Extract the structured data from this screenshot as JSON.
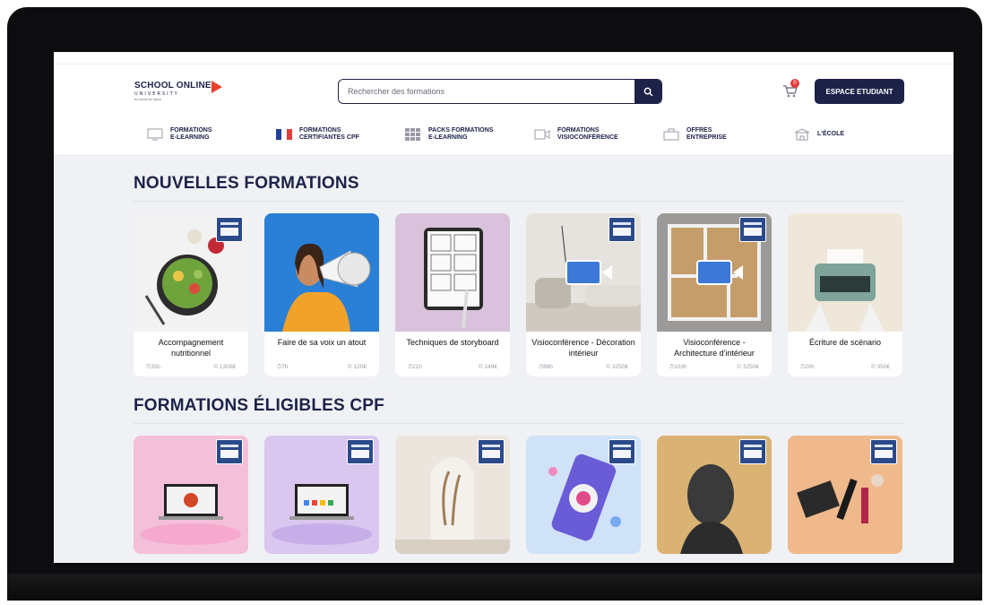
{
  "header": {
    "logo_text": "SCHOOL ONLINE",
    "logo_sub": "UNIVERSITY",
    "logo_tagline": "by ecole en ligne",
    "search_placeholder": "Rechercher des formations",
    "cart_count": "0",
    "espace_label": "ESPACE ETUDIANT"
  },
  "nav": [
    {
      "label": "FORMATIONS\nE-LEARNING",
      "icon": "monitor-icon"
    },
    {
      "label": "FORMATIONS\nCERTIFIANTES CPF",
      "icon": "flag-france-icon"
    },
    {
      "label": "PACKS FORMATIONS\nE-LEARNING",
      "icon": "grid-icon"
    },
    {
      "label": "FORMATIONS\nVISIOCONFÉRENCE",
      "icon": "video-icon"
    },
    {
      "label": "OFFRES\nENTREPRISE",
      "icon": "briefcase-icon"
    },
    {
      "label": "L'ÉCOLE",
      "icon": "school-icon"
    }
  ],
  "sections": {
    "new_title": "NOUVELLES FORMATIONS",
    "cpf_title": "FORMATIONS ÉLIGIBLES CPF"
  },
  "new_courses": [
    {
      "title": "Accompagnement nutritionnel",
      "duration": "35h",
      "price": "1300€"
    },
    {
      "title": "Faire de sa voix un atout",
      "duration": "7h",
      "price": "120€"
    },
    {
      "title": "Techniques de storyboard",
      "duration": "21h",
      "price": "149€"
    },
    {
      "title": "Visioconférence - Décoration intérieur",
      "duration": "88h",
      "price": "3250€"
    },
    {
      "title": "Visioconférence - Architecture d'intérieur",
      "duration": "103h",
      "price": "3250€"
    },
    {
      "title": "Écriture de scénario",
      "duration": "20h",
      "price": "350€"
    }
  ],
  "colors": {
    "brand_navy": "#1d2248",
    "logo_red": "#e8412c",
    "page_bg": "#f0f1f5"
  }
}
